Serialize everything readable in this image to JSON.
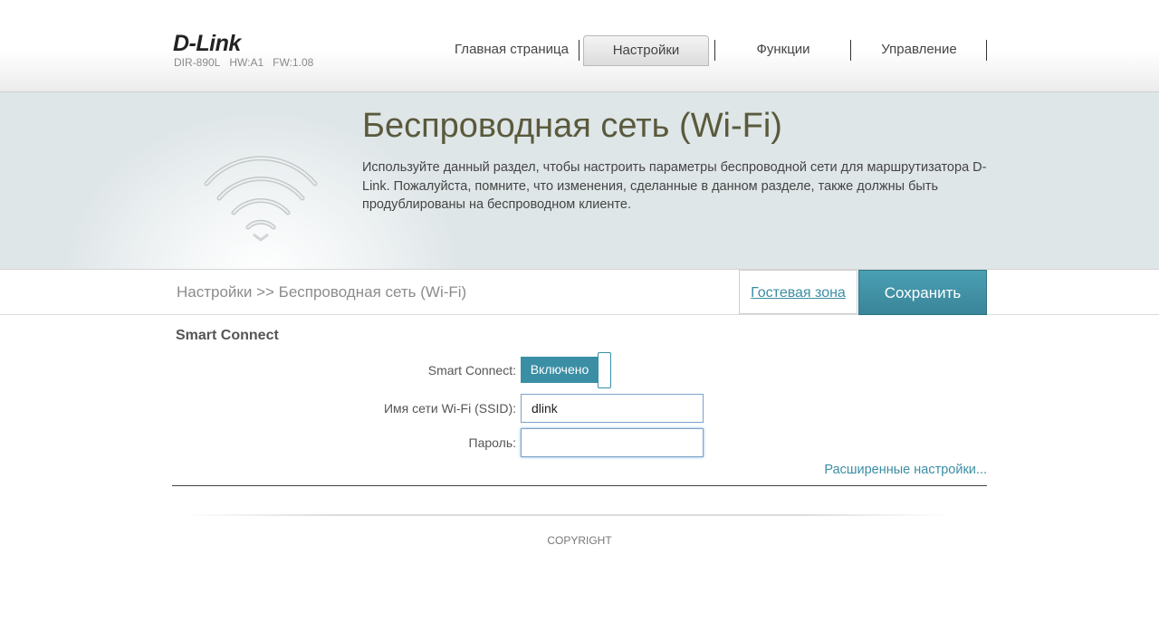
{
  "header": {
    "logo": "D-Link",
    "model": "DIR-890L",
    "hw": "HW:A1",
    "fw": "FW:1.08"
  },
  "nav": {
    "items": [
      {
        "label": "Главная страница"
      },
      {
        "label": "Настройки"
      },
      {
        "label": "Функции"
      },
      {
        "label": "Управление"
      }
    ],
    "active": "Настройки"
  },
  "banner": {
    "title": "Беспроводная сеть (Wi-Fi)",
    "description": "Используйте данный раздел, чтобы настроить параметры беспроводной сети для маршрутизатора D-Link. Пожалуйста, помните, что изменения, сделанные в данном разделе, также должны быть продублированы на беспроводном клиенте.",
    "icon": "wifi-icon"
  },
  "breadcrumb": "Настройки >> Беспроводная сеть (Wi-Fi)",
  "buttons": {
    "guest": "Гостевая зона",
    "save": "Сохранить"
  },
  "section": {
    "title": "Smart Connect",
    "smart_connect_label": "Smart Connect:",
    "smart_connect_value": "Включено",
    "ssid_label": "Имя сети Wi-Fi (SSID):",
    "ssid_value": "dlink",
    "password_label": "Пароль:",
    "password_value": "",
    "advanced_link": "Расширенные настройки..."
  },
  "footer": {
    "copyright": "COPYRIGHT"
  },
  "colors": {
    "accent": "#3a8fa5",
    "title": "#5a5a3c"
  }
}
